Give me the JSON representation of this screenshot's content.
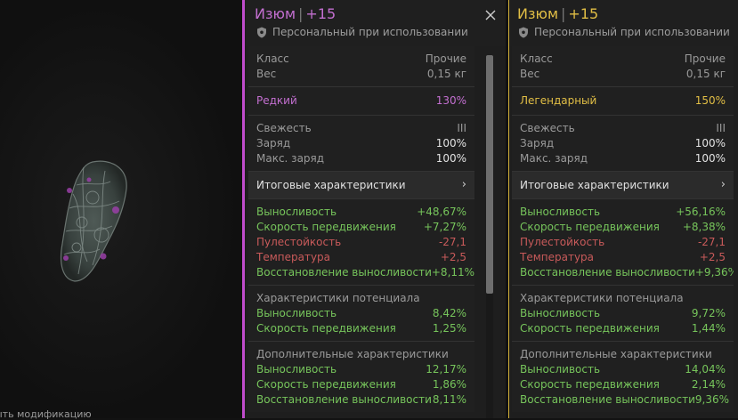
{
  "preview": {
    "bottom_hint": "ыть модификацию"
  },
  "left": {
    "name": "Изюм",
    "sep": "|",
    "level": "+15",
    "name_color": "#c36fd0",
    "binding": "Персональный при использовании",
    "info": [
      {
        "label": "Класс",
        "value": "Прочие"
      },
      {
        "label": "Вес",
        "value": "0,15 кг"
      }
    ],
    "rarity": {
      "label": "Редкий",
      "value": "130%",
      "color": "#c36fd0"
    },
    "charge": [
      {
        "label": "Свежесть",
        "value": "III"
      },
      {
        "label": "Заряд",
        "value": "100%"
      },
      {
        "label": "Макс. заряд",
        "value": "100%"
      }
    ],
    "summary_label": "Итоговые характеристики",
    "summary_chevron": "›",
    "totals": [
      {
        "label": "Выносливость",
        "value": "+48,67%",
        "kind": "pos"
      },
      {
        "label": "Скорость передвижения",
        "value": "+7,27%",
        "kind": "pos"
      },
      {
        "label": "Пулестойкость",
        "value": "-27,1",
        "kind": "neg"
      },
      {
        "label": "Температура",
        "value": "+2,5",
        "kind": "neg"
      },
      {
        "label": "Восстановление выносливости",
        "value": "+8,11%",
        "kind": "pos"
      }
    ],
    "potential_title": "Характеристики потенциала",
    "potential": [
      {
        "label": "Выносливость",
        "value": "8,42%"
      },
      {
        "label": "Скорость передвижения",
        "value": "1,25%"
      }
    ],
    "extra_title": "Дополнительные характеристики",
    "extra": [
      {
        "label": "Выносливость",
        "value": "12,17%"
      },
      {
        "label": "Скорость передвижения",
        "value": "1,86%"
      },
      {
        "label": "Восстановление выносливости",
        "value": "8,11%"
      }
    ]
  },
  "right": {
    "name": "Изюм",
    "sep": "|",
    "level": "+15",
    "name_color": "#e1be45",
    "binding": "Персональный при использовании",
    "info": [
      {
        "label": "Класс",
        "value": "Прочие"
      },
      {
        "label": "Вес",
        "value": "0,15 кг"
      }
    ],
    "rarity": {
      "label": "Легендарный",
      "value": "150%",
      "color": "#e1be45"
    },
    "charge": [
      {
        "label": "Свежесть",
        "value": "III"
      },
      {
        "label": "Заряд",
        "value": "100%"
      },
      {
        "label": "Макс. заряд",
        "value": "100%"
      }
    ],
    "summary_label": "Итоговые характеристики",
    "summary_chevron": "›",
    "totals": [
      {
        "label": "Выносливость",
        "value": "+56,16%",
        "kind": "pos"
      },
      {
        "label": "Скорость передвижения",
        "value": "+8,38%",
        "kind": "pos"
      },
      {
        "label": "Пулестойкость",
        "value": "-27,1",
        "kind": "neg"
      },
      {
        "label": "Температура",
        "value": "+2,5",
        "kind": "neg"
      },
      {
        "label": "Восстановление выносливости",
        "value": "+9,36%",
        "kind": "pos"
      }
    ],
    "potential_title": "Характеристики потенциала",
    "potential": [
      {
        "label": "Выносливость",
        "value": "9,72%"
      },
      {
        "label": "Скорость передвижения",
        "value": "1,44%"
      }
    ],
    "extra_title": "Дополнительные характеристики",
    "extra": [
      {
        "label": "Выносливость",
        "value": "14,04%"
      },
      {
        "label": "Скорость передвижения",
        "value": "2,14%"
      },
      {
        "label": "Восстановление выносливости",
        "value": "9,36%"
      }
    ]
  }
}
